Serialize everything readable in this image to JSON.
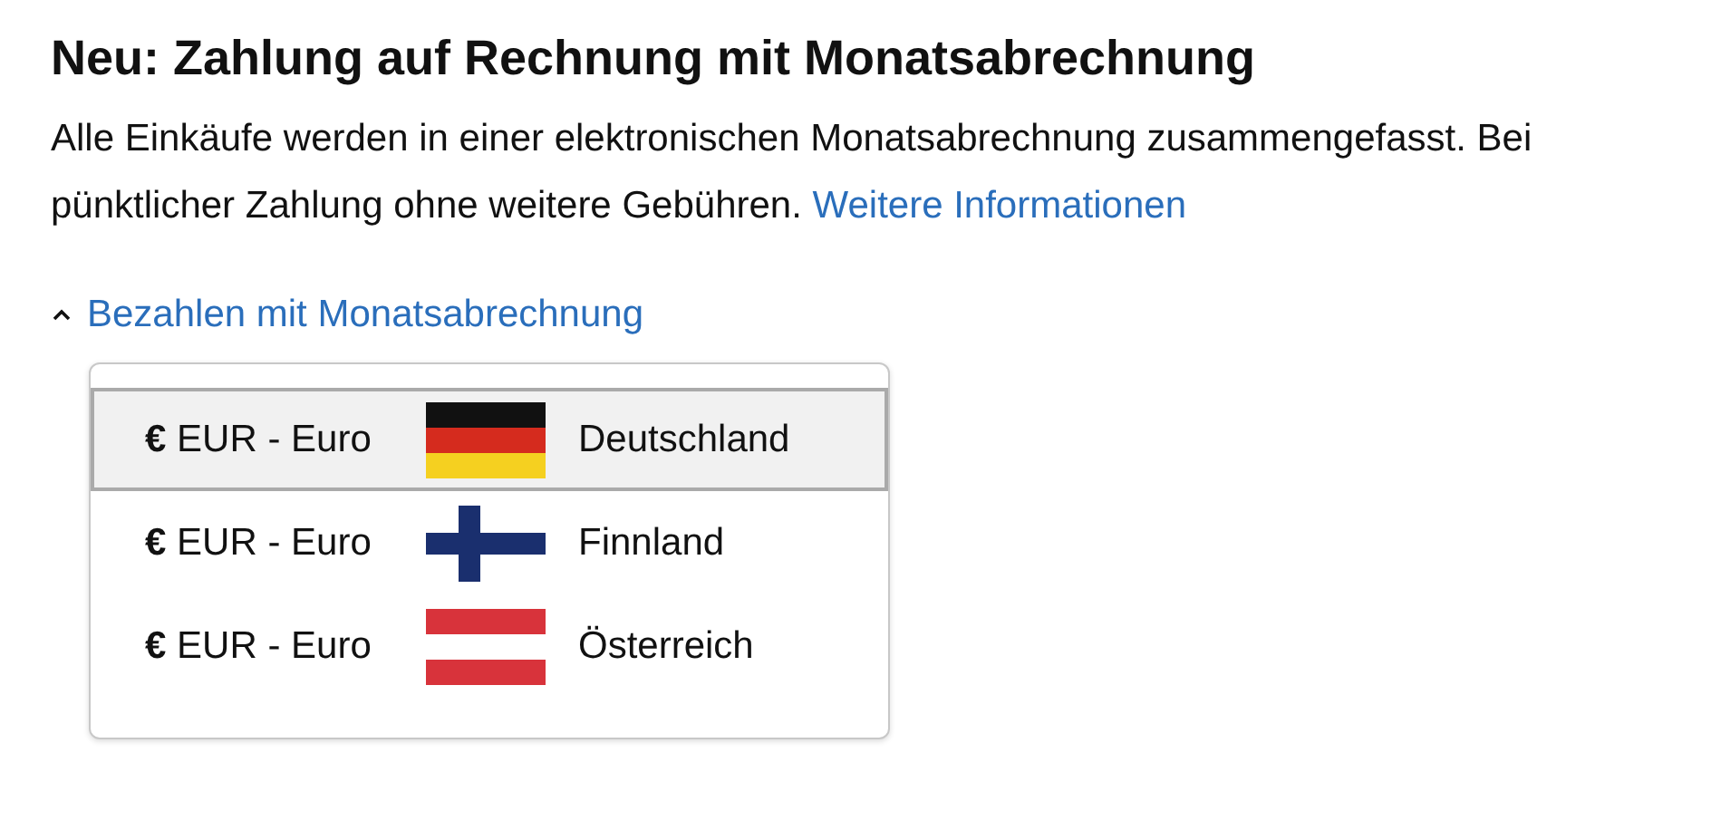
{
  "title": "Neu: Zahlung auf Rechnung mit Monatsabrechnung",
  "description": {
    "text": "Alle Einkäufe werden in einer elektronischen Monatsabrechnung zusammengefasst. Bei pünktlicher Zahlung ohne weitere Gebühren.",
    "link": "Weitere Informationen"
  },
  "expander": {
    "label": "Bezahlen mit Monatsabrechnung",
    "expanded": true
  },
  "options": [
    {
      "currency": "**€** EUR - Euro",
      "kind": "de",
      "country": "Deutschland",
      "selected": true
    },
    {
      "currency": "**€** EUR - Euro",
      "kind": "fi",
      "country": "Finnland",
      "selected": false
    },
    {
      "currency": "**€** EUR - Euro",
      "kind": "at",
      "country": "Österreich",
      "selected": false
    }
  ]
}
